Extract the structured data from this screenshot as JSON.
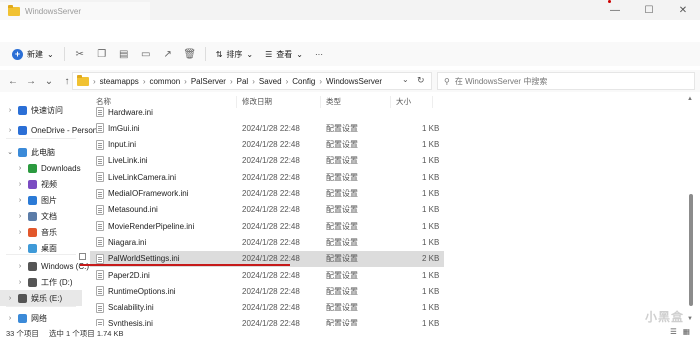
{
  "window": {
    "title": "WindowsServer",
    "controls": [
      "minimize",
      "maximize",
      "close"
    ]
  },
  "toolbar": {
    "new_label": "新建",
    "sort_label": "排序",
    "view_label": "查看",
    "more_label": "···"
  },
  "address": {
    "path": [
      "steamapps",
      "common",
      "PalServer",
      "Pal",
      "Saved",
      "Config",
      "WindowsServer"
    ],
    "search_placeholder": "在 WindowsServer 中搜索"
  },
  "nav": {
    "items": [
      {
        "label": "快速访问",
        "icon": "star-icon",
        "color": "#2b6fd6"
      },
      {
        "label": "OneDrive - Person",
        "icon": "cloud-icon",
        "color": "#2b6fd6"
      },
      {
        "label": "此电脑",
        "icon": "computer-icon",
        "color": "#3b8ad8"
      },
      {
        "label": "Downloads",
        "icon": "download-icon",
        "color": "#2b9a3f"
      },
      {
        "label": "视频",
        "icon": "video-icon",
        "color": "#7a4cc2"
      },
      {
        "label": "图片",
        "icon": "pictures-icon",
        "color": "#2b7ad6"
      },
      {
        "label": "文档",
        "icon": "documents-icon",
        "color": "#5b7ca8"
      },
      {
        "label": "音乐",
        "icon": "music-icon",
        "color": "#e2572b"
      },
      {
        "label": "桌面",
        "icon": "desktop-icon",
        "color": "#3f9ad8"
      },
      {
        "label": "Windows (C:)",
        "icon": "drive-icon",
        "color": "#555555"
      },
      {
        "label": "工作 (D:)",
        "icon": "drive-icon",
        "color": "#555555"
      },
      {
        "label": "娱乐 (E:)",
        "icon": "drive-icon",
        "color": "#555555"
      },
      {
        "label": "网络",
        "icon": "network-icon",
        "color": "#3b8ad8"
      }
    ]
  },
  "list": {
    "columns": [
      "名称",
      "修改日期",
      "类型",
      "大小"
    ],
    "rows": [
      {
        "name": "Hardware.ini",
        "date": "",
        "type": "",
        "size": ""
      },
      {
        "name": "ImGui.ini",
        "date": "2024/1/28 22:48",
        "type": "配置设置",
        "size": "1 KB"
      },
      {
        "name": "Input.ini",
        "date": "2024/1/28 22:48",
        "type": "配置设置",
        "size": "1 KB"
      },
      {
        "name": "LiveLink.ini",
        "date": "2024/1/28 22:48",
        "type": "配置设置",
        "size": "1 KB"
      },
      {
        "name": "LiveLinkCamera.ini",
        "date": "2024/1/28 22:48",
        "type": "配置设置",
        "size": "1 KB"
      },
      {
        "name": "MediaIOFramework.ini",
        "date": "2024/1/28 22:48",
        "type": "配置设置",
        "size": "1 KB"
      },
      {
        "name": "Metasound.ini",
        "date": "2024/1/28 22:48",
        "type": "配置设置",
        "size": "1 KB"
      },
      {
        "name": "MovieRenderPipeline.ini",
        "date": "2024/1/28 22:48",
        "type": "配置设置",
        "size": "1 KB"
      },
      {
        "name": "Niagara.ini",
        "date": "2024/1/28 22:48",
        "type": "配置设置",
        "size": "1 KB"
      },
      {
        "name": "PalWorldSettings.ini",
        "date": "2024/1/28 22:48",
        "type": "配置设置",
        "size": "2 KB"
      },
      {
        "name": "Paper2D.ini",
        "date": "2024/1/28 22:48",
        "type": "配置设置",
        "size": "1 KB"
      },
      {
        "name": "RuntimeOptions.ini",
        "date": "2024/1/28 22:48",
        "type": "配置设置",
        "size": "1 KB"
      },
      {
        "name": "Scalability.ini",
        "date": "2024/1/28 22:48",
        "type": "配置设置",
        "size": "1 KB"
      },
      {
        "name": "Synthesis.ini",
        "date": "2024/1/28 22:48",
        "type": "配置设置",
        "size": "1 KB"
      }
    ],
    "selected_index": 9
  },
  "status": {
    "count": "33 个项目",
    "selection": "选中 1 个项目  1.74 KB"
  },
  "watermark": "小黑盒"
}
